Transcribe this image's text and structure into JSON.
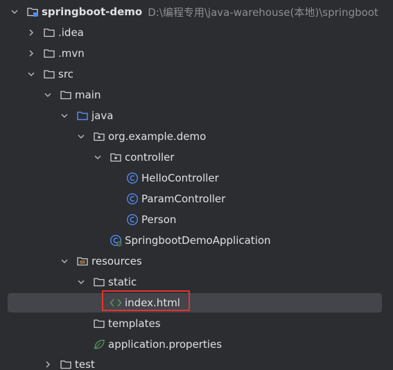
{
  "project": {
    "name": "springboot-demo",
    "path": "D:\\编程专用\\java-warehouse(本地)\\springboot"
  },
  "tree": {
    "idea": ".idea",
    "mvn": ".mvn",
    "src": "src",
    "main": "main",
    "java": "java",
    "package": "org.example.demo",
    "controller": "controller",
    "hello_controller": "HelloController",
    "param_controller": "ParamController",
    "person": "Person",
    "app_class": "SpringbootDemoApplication",
    "resources": "resources",
    "static": "static",
    "index_html": "index.html",
    "templates": "templates",
    "app_properties": "application.properties",
    "test": "test"
  },
  "colors": {
    "background": "#2b2d30",
    "selected_row": "#43454a",
    "highlight_border": "#e5332f",
    "class_icon": "#548af7",
    "html_icon": "#57965c",
    "text": "#dfe1e5",
    "path_text": "#8c8f94"
  }
}
